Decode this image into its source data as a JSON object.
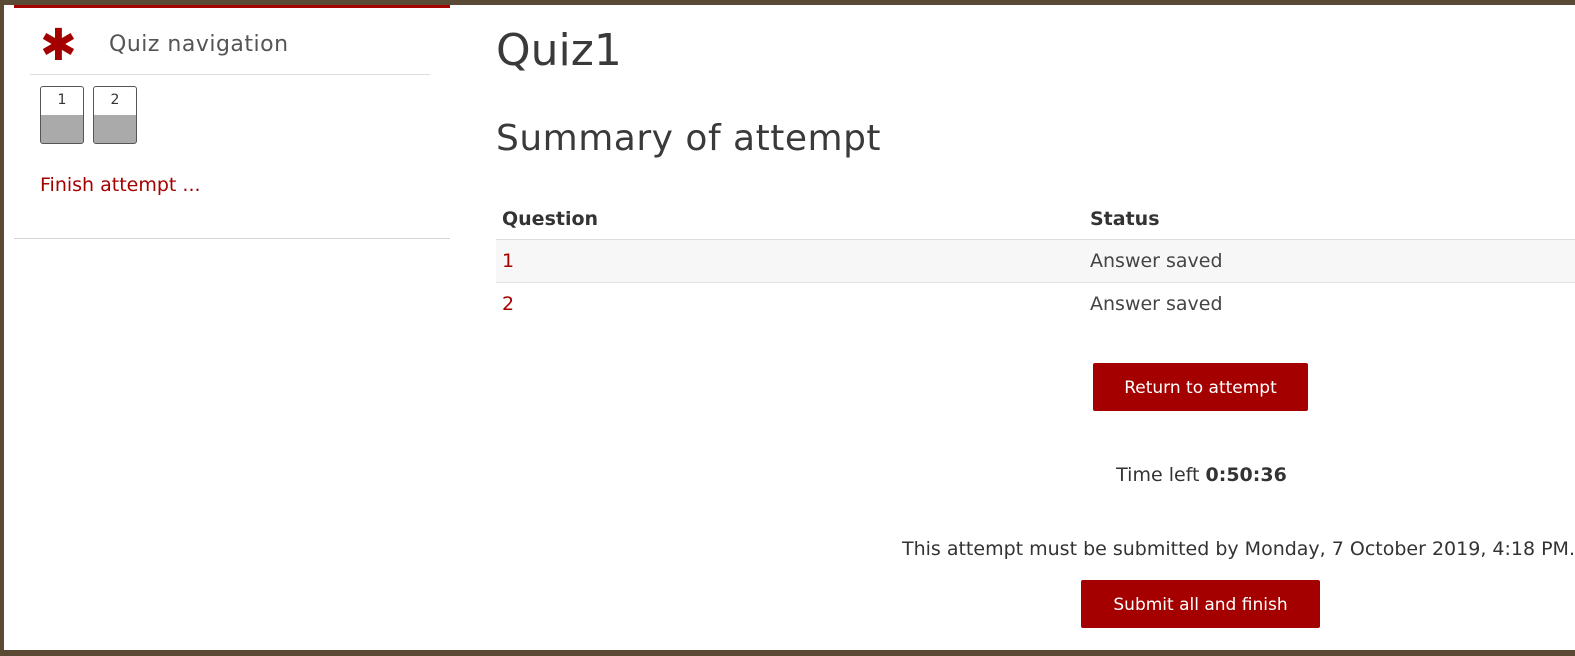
{
  "sidebar": {
    "title": "Quiz navigation",
    "icon": "asterisk-icon",
    "questions": [
      "1",
      "2"
    ],
    "finish_link": "Finish attempt ..."
  },
  "main": {
    "title": "Quiz1",
    "heading": "Summary of attempt",
    "table": {
      "headers": [
        "Question",
        "Status"
      ],
      "rows": [
        {
          "question": "1",
          "status": "Answer saved"
        },
        {
          "question": "2",
          "status": "Answer saved"
        }
      ]
    },
    "return_button": "Return to attempt",
    "timer_label": "Time left",
    "timer_value": "0:50:36",
    "deadline_text": "This attempt must be submitted by Monday, 7 October 2019, 4:18 PM.",
    "submit_button": "Submit all and finish"
  },
  "colors": {
    "accent": "#a50000",
    "frame": "#5a4a35"
  }
}
